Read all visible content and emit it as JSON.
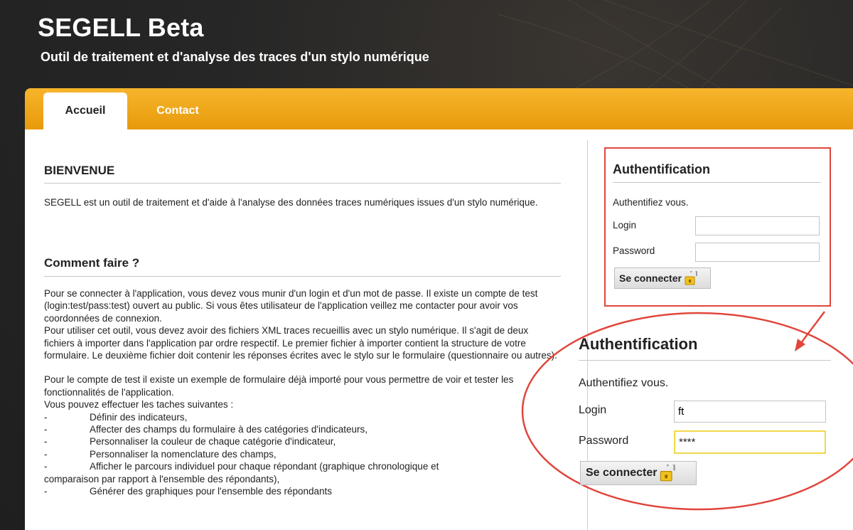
{
  "header": {
    "title": "SEGELL Beta",
    "subtitle": "Outil de traitement et d'analyse des traces d'un stylo numérique"
  },
  "nav": {
    "tabs": [
      {
        "label": "Accueil",
        "active": true
      },
      {
        "label": "Contact",
        "active": false
      }
    ]
  },
  "main": {
    "welcome_heading": "BIENVENUE",
    "welcome_text": "SEGELL est un outil de traitement et d'aide à l'analyse des données traces numériques issues d'un stylo numérique.",
    "howto_heading": "Comment faire ?",
    "howto_paragraph_1": "Pour se connecter à l'application, vous devez vous munir d'un login et d'un mot de passe. Il existe un compte de test (login:test/pass:test) ouvert au public. Si vous êtes utilisateur de l'application veillez me contacter pour avoir vos coordonnées de connexion.",
    "howto_paragraph_2": "Pour utiliser cet outil, vous devez avoir des fichiers XML traces recueillis avec un stylo numérique. Il s'agit de deux fichiers à importer dans l'application par ordre respectif. Le premier fichier à importer contient la structure de votre formulaire. Le deuxième fichier doit contenir les réponses écrites avec le stylo sur le formulaire (questionnaire ou autres).",
    "test_paragraph": "Pour le compte de test il existe un exemple de formulaire déjà importé pour vous permettre de voir et tester les fonctionnalités de l'application.",
    "tasks_intro": "Vous pouvez effectuer les taches suivantes :",
    "tasks": [
      {
        "dash": "-",
        "text": "Définir des indicateurs,"
      },
      {
        "dash": "-",
        "text": "Affecter des champs du formulaire à des catégories d'indicateurs,"
      },
      {
        "dash": "-",
        "text": "Personnaliser la couleur de chaque catégorie d'indicateur,"
      },
      {
        "dash": "-",
        "text": "Personnaliser la nomenclature des champs,"
      },
      {
        "dash": "-",
        "text": "Afficher le parcours individuel pour chaque répondant (graphique chronologique et"
      }
    ],
    "task_continuation": "comparaison par rapport à l'ensemble des répondants),",
    "last_task": {
      "dash": "-",
      "text": "Générer des graphiques pour l'ensemble des répondants"
    }
  },
  "auth": {
    "title": "Authentification",
    "hint": "Authentifiez vous.",
    "login_label": "Login",
    "login_value": "",
    "password_label": "Password",
    "password_value": "",
    "submit_label": "Se connecter"
  },
  "auth_zoom": {
    "title": "Authentification",
    "hint": "Authentifiez vous.",
    "login_label": "Login",
    "login_value": "ft",
    "password_label": "Password",
    "password_value": "****",
    "submit_label": "Se connecter"
  },
  "colors": {
    "accent_orange": "#f0a81c",
    "annotation_red": "#e0463c",
    "focus_yellow": "#f2d84a"
  }
}
